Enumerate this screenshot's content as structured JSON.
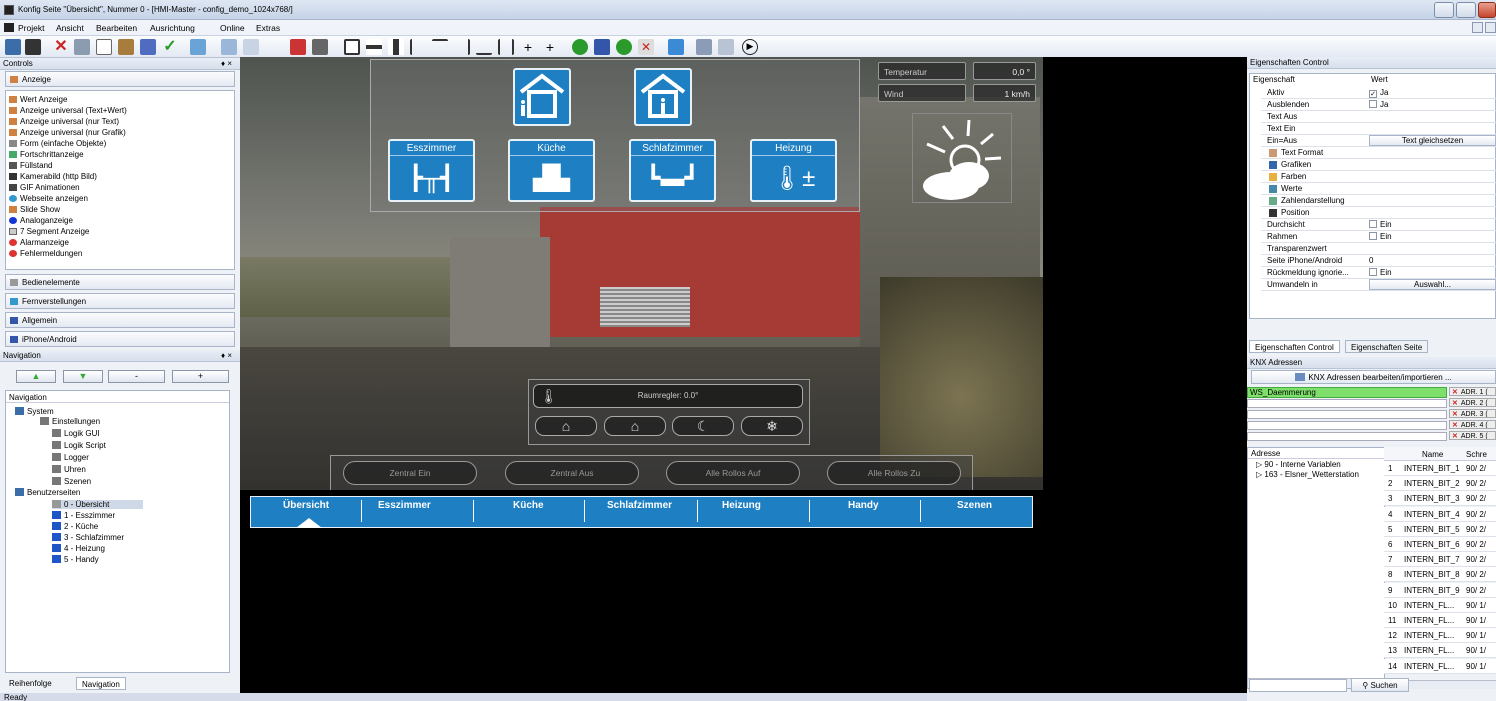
{
  "window": {
    "title": "Konfig Seite \"Übersicht\", Nummer 0  - [HMI-Master - config_demo_1024x768/]"
  },
  "menu": [
    {
      "label": "Projekt"
    },
    {
      "label": "Ansicht"
    },
    {
      "label": "Bearbeiten"
    },
    {
      "label": "Ausrichtung"
    },
    {
      "label": "Online"
    },
    {
      "label": "Extras"
    }
  ],
  "controls": {
    "title": "Controls",
    "pin": "♦ ×",
    "group_anzeige": "Anzeige",
    "items": [
      "Wert Anzeige",
      "Anzeige universal (Text+Wert)",
      "Anzeige universal (nur Text)",
      "Anzeige universal (nur Grafik)",
      "Form (einfache Objekte)",
      "Fortschrittanzeige",
      "Füllstand",
      "Kamerabild (http Bild)",
      "GIF Animationen",
      "Webseite anzeigen",
      "Slide Show",
      "Analoganzeige",
      "7 Segment Anzeige",
      "Alarmanzeige",
      "Fehlermeldungen"
    ],
    "groups": [
      "Bedienelemente",
      "Fernverstellungen",
      "Allgemein",
      "iPhone/Android"
    ]
  },
  "navigation": {
    "title": "Navigation",
    "pin": "♦ ×",
    "btn_minus": "-",
    "btn_plus": "+",
    "tree_header": "Navigation",
    "tree": [
      {
        "label": "System",
        "level": 0
      },
      {
        "label": "Einstellungen",
        "level": 1
      },
      {
        "label": "Logik GUI",
        "level": 1
      },
      {
        "label": "Logik Script",
        "level": 1
      },
      {
        "label": "Logger",
        "level": 1
      },
      {
        "label": "Uhren",
        "level": 1
      },
      {
        "label": "Szenen",
        "level": 1
      },
      {
        "label": "Benutzerseiten",
        "level": 0
      },
      {
        "label": "0 - Übersicht",
        "level": 1
      },
      {
        "label": "1 - Esszimmer",
        "level": 1
      },
      {
        "label": "2 - Küche",
        "level": 1
      },
      {
        "label": "3 - Schlafzimmer",
        "level": 1
      },
      {
        "label": "4 - Heizung",
        "level": 1
      },
      {
        "label": "5 - Handy",
        "level": 1
      }
    ],
    "tabs": [
      "Reihenfolge",
      "Navigation"
    ]
  },
  "hmi": {
    "rooms": [
      "Esszimmer",
      "Küche",
      "Schlafzimmer",
      "Heizung"
    ],
    "temperatur_label": "Temperatur",
    "temperatur_value": "0,0 °",
    "wind_label": "Wind",
    "wind_value": "1 km/h",
    "raumregler": "Raumregler: 0.0°",
    "zentral": [
      "Zentral Ein",
      "Zentral Aus",
      "Alle Rollos Auf",
      "Alle Rollos Zu"
    ],
    "nav": [
      "Übersicht",
      "Esszimmer",
      "Küche",
      "Schlafzimmer",
      "Heizung",
      "Handy",
      "Szenen"
    ]
  },
  "properties": {
    "title": "Eigenschaften Control",
    "col_key": "Eigenschaft",
    "col_val": "Wert",
    "rows": [
      {
        "k": "Aktiv",
        "v": "Ja",
        "chk": "✓"
      },
      {
        "k": "Ausblenden",
        "v": "Ja",
        "chk": " "
      },
      {
        "k": "Text Aus",
        "v": ""
      },
      {
        "k": "Text Ein",
        "v": ""
      },
      {
        "k": "Ein=Aus",
        "v": "Text gleichsetzen",
        "btn": true
      },
      {
        "k": "Text Format",
        "v": ""
      },
      {
        "k": "Grafiken",
        "v": ""
      },
      {
        "k": "Farben",
        "v": ""
      },
      {
        "k": "Werte",
        "v": ""
      },
      {
        "k": "Zahlendarstellung",
        "v": ""
      },
      {
        "k": "Position",
        "v": ""
      },
      {
        "k": "Durchsicht",
        "v": "Ein",
        "chk": " "
      },
      {
        "k": "Rahmen",
        "v": "Ein",
        "chk": " "
      },
      {
        "k": "Transparenzwert",
        "v": ""
      },
      {
        "k": "Seite iPhone/Android",
        "v": "0"
      },
      {
        "k": "Rückmeldung ignorie...",
        "v": "Ein",
        "chk": " "
      },
      {
        "k": "Umwandeln in",
        "v": "Auswahl...",
        "btn": true
      }
    ],
    "tabs": [
      "Eigenschaften Control",
      "Eigenschaften Seite"
    ]
  },
  "knx": {
    "title": "KNX Adressen",
    "edit_btn": "KNX Adressen bearbeiten/importieren ...",
    "selected": "WS_Daemmerung",
    "adr_buttons": [
      "ADR. 1 (",
      "ADR. 2 (",
      "ADR. 3 (",
      "ADR. 4 (",
      "ADR. 5 ("
    ],
    "tree_header": "Adresse",
    "tree": [
      "90 - Interne Variablen",
      "163 - Elsner_Wetterstation"
    ],
    "col_name": "Name",
    "col_schr": "Schre",
    "rows": [
      {
        "n": "1",
        "name": "INTERN_BIT_1",
        "s": "90/ 2/"
      },
      {
        "n": "2",
        "name": "INTERN_BIT_2",
        "s": "90/ 2/"
      },
      {
        "n": "3",
        "name": "INTERN_BIT_3",
        "s": "90/ 2/"
      },
      {
        "n": "4",
        "name": "INTERN_BIT_4",
        "s": "90/ 2/"
      },
      {
        "n": "5",
        "name": "INTERN_BIT_5",
        "s": "90/ 2/"
      },
      {
        "n": "6",
        "name": "INTERN_BIT_6",
        "s": "90/ 2/"
      },
      {
        "n": "7",
        "name": "INTERN_BIT_7",
        "s": "90/ 2/"
      },
      {
        "n": "8",
        "name": "INTERN_BIT_8",
        "s": "90/ 2/"
      },
      {
        "n": "9",
        "name": "INTERN_BIT_9",
        "s": "90/ 2/"
      },
      {
        "n": "10",
        "name": "INTERN_FL...",
        "s": "90/ 1/"
      },
      {
        "n": "11",
        "name": "INTERN_FL...",
        "s": "90/ 1/"
      },
      {
        "n": "12",
        "name": "INTERN_FL...",
        "s": "90/ 1/"
      },
      {
        "n": "13",
        "name": "INTERN_FL...",
        "s": "90/ 1/"
      },
      {
        "n": "14",
        "name": "INTERN_FL...",
        "s": "90/ 1/"
      }
    ],
    "search_btn": "Suchen",
    "scroll_mark": "III"
  },
  "status": "Ready"
}
